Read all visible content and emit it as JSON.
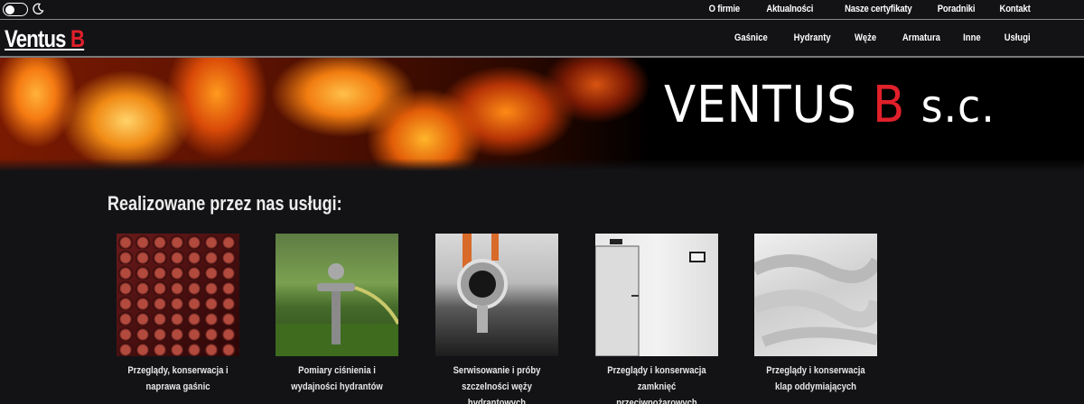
{
  "top_nav": [
    "O firmie",
    "Aktualności",
    "Nasze certyfikaty",
    "Poradniki",
    "Kontakt"
  ],
  "logo": {
    "main": "Ventus",
    "accent": "B"
  },
  "main_nav": [
    "Gaśnice",
    "Hydranty",
    "Węże",
    "Armatura",
    "Inne",
    "Usługi"
  ],
  "banner": {
    "title_main": "VENTUS",
    "title_accent": "B",
    "title_suffix": "s.c."
  },
  "section_title": "Realizowane przez nas usługi:",
  "services": [
    {
      "caption": "Przeglądy, konserwacja i naprawa gaśnic"
    },
    {
      "caption": "Pomiary ciśnienia i wydajności hydrantów"
    },
    {
      "caption": "Serwisowanie i próby szczelności węży hydrantowych"
    },
    {
      "caption": "Przeglądy i konserwacja zamknięć przeciwpożarowych"
    },
    {
      "caption": "Przeglądy i konserwacja klap oddymiających"
    }
  ],
  "colors": {
    "accent": "#e0202a",
    "background": "#131316"
  }
}
